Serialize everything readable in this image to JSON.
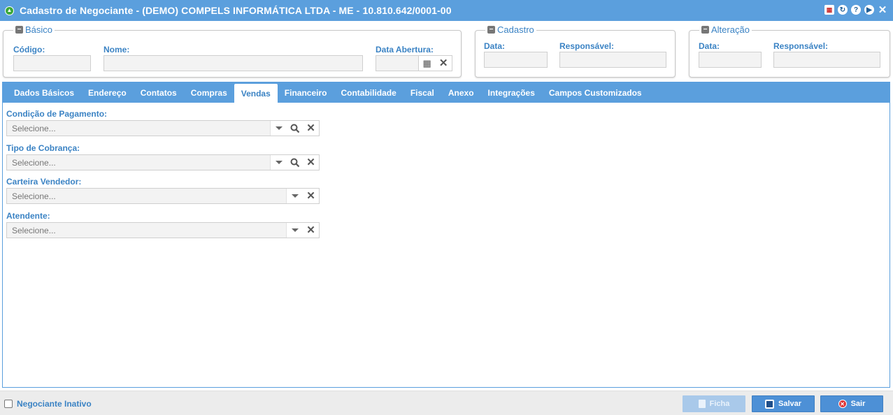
{
  "window": {
    "title": "Cadastro de Negociante - (DEMO) COMPELS INFORMÁTICA LTDA - ME - 10.810.642/0001-00",
    "actions": [
      "calendar-icon",
      "refresh-icon",
      "help-icon",
      "play-icon",
      "close-icon"
    ]
  },
  "basico": {
    "legend": "Básico",
    "codigo_label": "Código:",
    "nome_label": "Nome:",
    "data_abertura_label": "Data Abertura:",
    "codigo_value": "",
    "nome_value": "",
    "data_abertura_value": ""
  },
  "cadastro": {
    "legend": "Cadastro",
    "data_label": "Data:",
    "responsavel_label": "Responsável:"
  },
  "alteracao": {
    "legend": "Alteração",
    "data_label": "Data:",
    "responsavel_label": "Responsável:"
  },
  "tabs": [
    {
      "label": "Dados Básicos",
      "active": false
    },
    {
      "label": "Endereço",
      "active": false
    },
    {
      "label": "Contatos",
      "active": false
    },
    {
      "label": "Compras",
      "active": false
    },
    {
      "label": "Vendas",
      "active": true
    },
    {
      "label": "Financeiro",
      "active": false
    },
    {
      "label": "Contabilidade",
      "active": false
    },
    {
      "label": "Fiscal",
      "active": false
    },
    {
      "label": "Anexo",
      "active": false
    },
    {
      "label": "Integrações",
      "active": false
    },
    {
      "label": "Campos Customizados",
      "active": false
    }
  ],
  "vendas": {
    "condicao_pagamento": {
      "label": "Condição de Pagamento:",
      "placeholder": "Selecione..."
    },
    "tipo_cobranca": {
      "label": "Tipo de Cobrança:",
      "placeholder": "Selecione..."
    },
    "carteira_vendedor": {
      "label": "Carteira Vendedor:",
      "placeholder": "Selecione..."
    },
    "atendente": {
      "label": "Atendente:",
      "placeholder": "Selecione..."
    }
  },
  "footer": {
    "inativo_label": "Negociante Inativo",
    "ficha_label": "Ficha",
    "salvar_label": "Salvar",
    "sair_label": "Sair"
  },
  "colors": {
    "accent": "#5b9fdd",
    "label": "#3b83c4"
  }
}
